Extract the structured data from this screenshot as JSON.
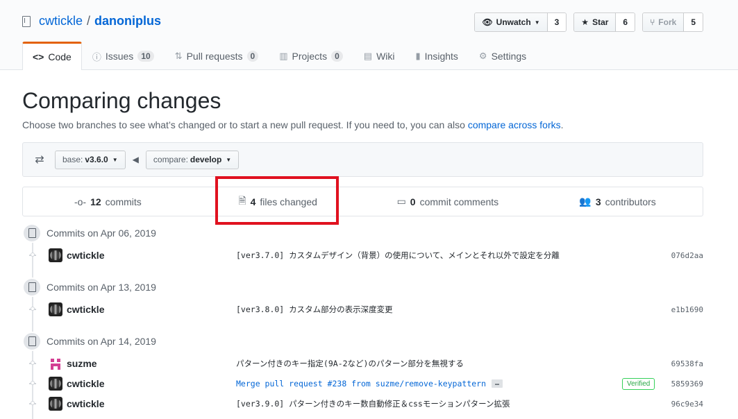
{
  "repo": {
    "owner": "cwtickle",
    "separator": "/",
    "name": "danoniplus"
  },
  "actions": {
    "watch": {
      "label": "Unwatch",
      "count": "3"
    },
    "star": {
      "label": "Star",
      "count": "6"
    },
    "fork": {
      "label": "Fork",
      "count": "5"
    }
  },
  "tabs": [
    {
      "label": "Code",
      "icon": "code-icon"
    },
    {
      "label": "Issues",
      "count": "10",
      "icon": "issue-icon"
    },
    {
      "label": "Pull requests",
      "count": "0",
      "icon": "pull-request-icon"
    },
    {
      "label": "Projects",
      "count": "0",
      "icon": "project-icon"
    },
    {
      "label": "Wiki",
      "icon": "book-icon"
    },
    {
      "label": "Insights",
      "icon": "graph-icon"
    },
    {
      "label": "Settings",
      "icon": "gear-icon"
    }
  ],
  "page": {
    "title": "Comparing changes",
    "subtitle": "Choose two branches to see what’s changed or to start a new pull request. If you need to, you can also ",
    "subtitle_link": "compare across forks",
    "subtitle_end": "."
  },
  "range": {
    "base_prefix": "base:",
    "base_value": "v3.6.0",
    "compare_prefix": "compare:",
    "compare_value": "develop"
  },
  "summary": {
    "commits_count": "12",
    "commits_label": "commits",
    "files_count": "4",
    "files_label": "files changed",
    "comments_count": "0",
    "comments_label": "commit comments",
    "contributors_count": "3",
    "contributors_label": "contributors"
  },
  "commit_groups": [
    {
      "date": "Commits on Apr 06, 2019",
      "commits": [
        {
          "author": "cwtickle",
          "message": "[ver3.7.0] カスタムデザイン（背景）の使用について、メインとそれ以外で設定を分離",
          "sha": "076d2aa"
        }
      ]
    },
    {
      "date": "Commits on Apr 13, 2019",
      "commits": [
        {
          "author": "cwtickle",
          "message": "[ver3.8.0] カスタム部分の表示深度変更",
          "sha": "e1b1690"
        }
      ]
    },
    {
      "date": "Commits on Apr 14, 2019",
      "commits": [
        {
          "author": "suzme",
          "message": "パターン付きのキー指定(9A-2など)のパターン部分を無視する",
          "sha": "69538fa"
        },
        {
          "author": "cwtickle",
          "message": "Merge pull request #238 from suzme/remove-keypattern",
          "ellipsis": "…",
          "verified": "Verified",
          "sha": "5859369"
        },
        {
          "author": "cwtickle",
          "message": "[ver3.9.0] パターン付きのキー数自動修正＆cssモーションパターン拡張",
          "sha": "96c9e34"
        }
      ]
    }
  ]
}
